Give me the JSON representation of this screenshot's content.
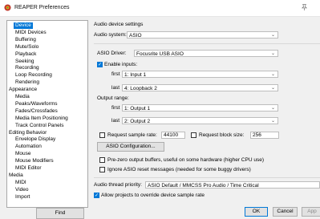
{
  "window": {
    "title": "REAPER Preferences",
    "icon": "reaper-logo-icon",
    "pin_icon": "pin-icon"
  },
  "tree": {
    "items": [
      {
        "label": "Device",
        "level": 1,
        "selected": true
      },
      {
        "label": "MIDI Devices",
        "level": 1
      },
      {
        "label": "Buffering",
        "level": 1
      },
      {
        "label": "Mute/Solo",
        "level": 1
      },
      {
        "label": "Playback",
        "level": 1
      },
      {
        "label": "Seeking",
        "level": 1
      },
      {
        "label": "Recording",
        "level": 1
      },
      {
        "label": "Loop Recording",
        "level": 1
      },
      {
        "label": "Rendering",
        "level": 1
      },
      {
        "label": "Appearance",
        "level": 0
      },
      {
        "label": "Media",
        "level": 1
      },
      {
        "label": "Peaks/Waveforms",
        "level": 1
      },
      {
        "label": "Fades/Crossfades",
        "level": 1
      },
      {
        "label": "Media Item Positioning",
        "level": 1
      },
      {
        "label": "Track Control Panels",
        "level": 1
      },
      {
        "label": "Editing Behavior",
        "level": 0
      },
      {
        "label": "Envelope Display",
        "level": 1
      },
      {
        "label": "Automation",
        "level": 1
      },
      {
        "label": "Mouse",
        "level": 1
      },
      {
        "label": "Mouse Modifiers",
        "level": 1
      },
      {
        "label": "MIDI Editor",
        "level": 1
      },
      {
        "label": "Media",
        "level": 0
      },
      {
        "label": "MIDI",
        "level": 1
      },
      {
        "label": "Video",
        "level": 1
      },
      {
        "label": "Import",
        "level": 1
      }
    ]
  },
  "find_label": "Find",
  "panel": {
    "heading": "Audio device settings",
    "audio_system_label": "Audio system:",
    "audio_system_value": "ASIO",
    "asio_driver_label": "ASIO Driver:",
    "asio_driver_value": "Focusrite USB ASIO",
    "enable_inputs_label": "Enable inputs:",
    "enable_inputs_checked": true,
    "inputs_first_label": "first",
    "inputs_first_value": "1: Input 1",
    "inputs_last_label": "last",
    "inputs_last_value": "4: Loopback 2",
    "output_range_label": "Output range:",
    "outputs_first_label": "first",
    "outputs_first_value": "1: Output 1",
    "outputs_last_label": "last",
    "outputs_last_value": "2: Output 2",
    "request_sample_rate_label": "Request sample rate:",
    "request_sample_rate_checked": false,
    "sample_rate_value": "44100",
    "request_block_size_label": "Request block size:",
    "request_block_size_checked": false,
    "block_size_value": "256",
    "asio_config_label": "ASIO Configuration...",
    "pre_zero_label": "Pre-zero output buffers, useful on some hardware (higher CPU use)",
    "pre_zero_checked": false,
    "ignore_reset_label": "Ignore ASIO reset messages (needed for some buggy drivers)",
    "ignore_reset_checked": false,
    "thread_priority_label": "Audio thread priority:",
    "thread_priority_value": "ASIO Default / MMCSS Pro Audio / Time Critical",
    "allow_override_label": "Allow projects to override device sample rate",
    "allow_override_checked": true
  },
  "footer": {
    "ok_label": "OK",
    "cancel_label": "Cancel",
    "apply_label": "App"
  },
  "colors": {
    "accent": "#0078d7",
    "window_bg": "#f0f0f0"
  }
}
